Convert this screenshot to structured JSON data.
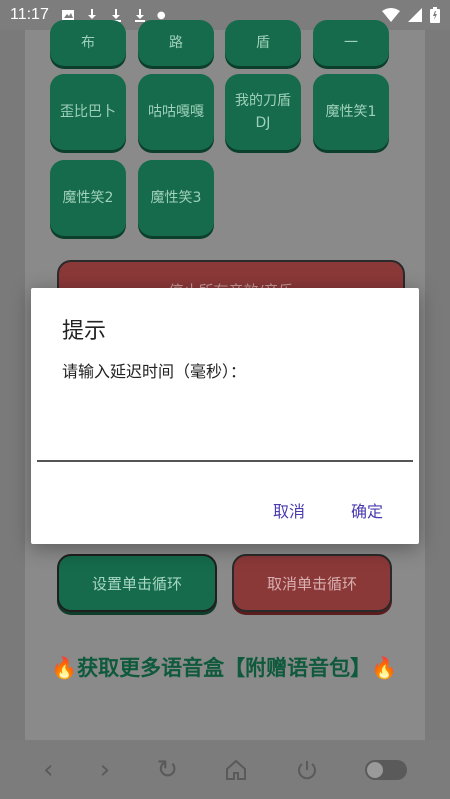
{
  "status_bar": {
    "time": "11:17"
  },
  "soundboard": {
    "pads_top_partial": [
      "布",
      "路",
      "盾",
      "一"
    ],
    "pads": [
      [
        "歪比巴卜",
        "咕咕嘎嘎",
        "我的刀盾DJ",
        "魔性笑1"
      ],
      [
        "魔性笑2",
        "魔性笑3"
      ]
    ],
    "stop_all_label": "停止所有音效/音乐",
    "set_loop_label": "设置单击循环",
    "cancel_loop_label": "取消单击循环"
  },
  "promo": {
    "text": "获取更多语音盒【附赠语音包】"
  },
  "dialog": {
    "title": "提示",
    "message": "请输入延迟时间（毫秒）：",
    "input_value": "",
    "cancel_label": "取消",
    "confirm_label": "确定"
  },
  "colors": {
    "accent_green": "#156b4b",
    "accent_red": "#8b3838",
    "dialog_button": "#4a3bb0"
  }
}
